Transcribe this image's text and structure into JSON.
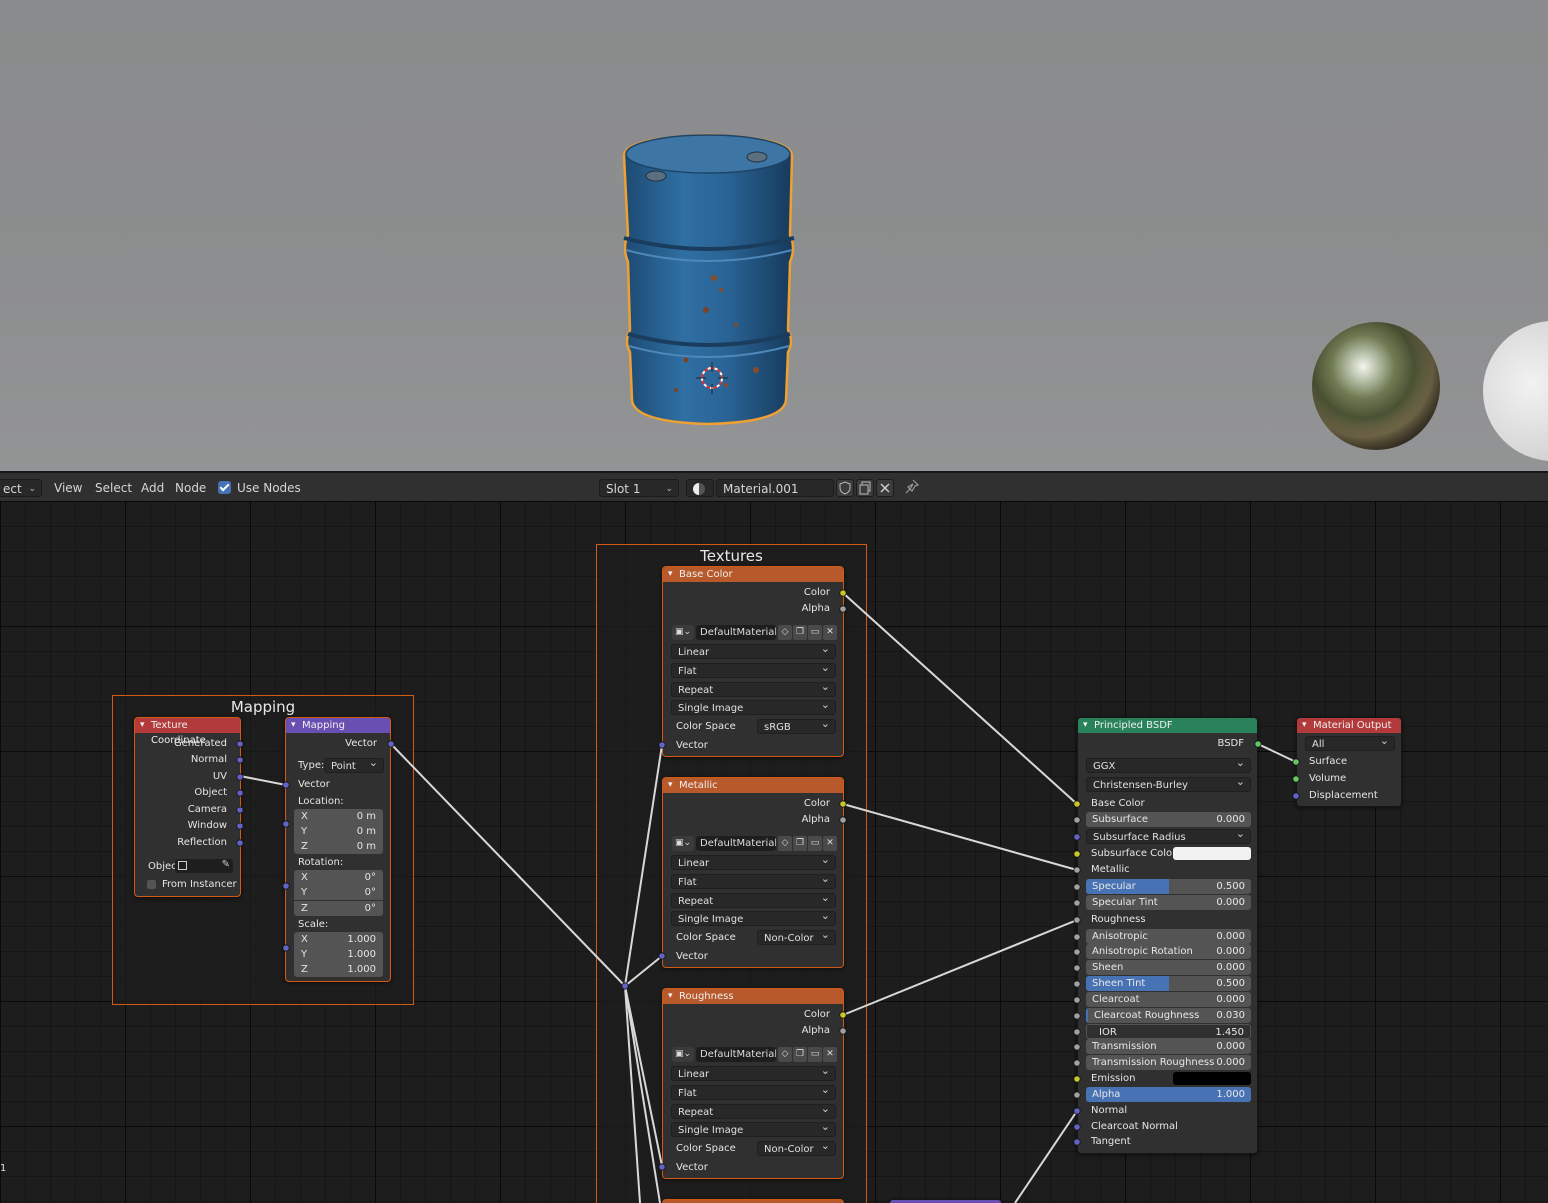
{
  "header": {
    "editor_type": "ect",
    "menu": [
      "View",
      "Select",
      "Add",
      "Node"
    ],
    "use_nodes_label": "Use Nodes",
    "slot": "Slot 1",
    "material_name": "Material.001"
  },
  "frames": {
    "mapping": "Mapping",
    "textures": "Textures"
  },
  "texture_coordinate": {
    "title": "Texture Coordinate",
    "outputs": [
      "Generated",
      "Normal",
      "UV",
      "Object",
      "Camera",
      "Window",
      "Reflection"
    ],
    "object_label": "Objec",
    "from_instancer": "From Instancer"
  },
  "mapping_node": {
    "title": "Mapping",
    "output": "Vector",
    "type_label": "Type:",
    "type_value": "Point",
    "input_vector": "Vector",
    "location_label": "Location:",
    "location": [
      {
        "axis": "X",
        "value": "0 m"
      },
      {
        "axis": "Y",
        "value": "0 m"
      },
      {
        "axis": "Z",
        "value": "0 m"
      }
    ],
    "rotation_label": "Rotation:",
    "rotation": [
      {
        "axis": "X",
        "value": "0°"
      },
      {
        "axis": "Y",
        "value": "0°"
      },
      {
        "axis": "Z",
        "value": "0°"
      }
    ],
    "scale_label": "Scale:",
    "scale": [
      {
        "axis": "X",
        "value": "1.000"
      },
      {
        "axis": "Y",
        "value": "1.000"
      },
      {
        "axis": "Z",
        "value": "1.000"
      }
    ]
  },
  "image_nodes": [
    {
      "title": "Base Color",
      "color_out": "Color",
      "alpha_out": "Alpha",
      "image": "DefaultMaterial_...",
      "interpolation": "Linear",
      "projection": "Flat",
      "extension": "Repeat",
      "source": "Single Image",
      "color_space_label": "Color Space",
      "color_space": "sRGB",
      "vector_in": "Vector"
    },
    {
      "title": "Metallic",
      "color_out": "Color",
      "alpha_out": "Alpha",
      "image": "DefaultMaterial_...",
      "interpolation": "Linear",
      "projection": "Flat",
      "extension": "Repeat",
      "source": "Single Image",
      "color_space_label": "Color Space",
      "color_space": "Non-Color",
      "vector_in": "Vector"
    },
    {
      "title": "Roughness",
      "color_out": "Color",
      "alpha_out": "Alpha",
      "image": "DefaultMaterial_...",
      "interpolation": "Linear",
      "projection": "Flat",
      "extension": "Repeat",
      "source": "Single Image",
      "color_space_label": "Color Space",
      "color_space": "Non-Color",
      "vector_in": "Vector"
    }
  ],
  "principled": {
    "title": "Principled BSDF",
    "output": "BSDF",
    "distribution": "GGX",
    "subsurface_method": "Christensen-Burley",
    "base_color": "Base Color",
    "subsurface": {
      "label": "Subsurface",
      "value": "0.000"
    },
    "subsurface_radius": "Subsurface Radius",
    "subsurface_color": "Subsurface Color",
    "metallic": "Metallic",
    "specular": {
      "label": "Specular",
      "value": "0.500",
      "fraction": 0.5
    },
    "specular_tint": {
      "label": "Specular Tint",
      "value": "0.000"
    },
    "roughness": "Roughness",
    "anisotropic": {
      "label": "Anisotropic",
      "value": "0.000"
    },
    "anisotropic_rotation": {
      "label": "Anisotropic Rotation",
      "value": "0.000"
    },
    "sheen": {
      "label": "Sheen",
      "value": "0.000"
    },
    "sheen_tint": {
      "label": "Sheen Tint",
      "value": "0.500",
      "fraction": 0.5
    },
    "clearcoat": {
      "label": "Clearcoat",
      "value": "0.000"
    },
    "clearcoat_roughness": {
      "label": "Clearcoat Roughness",
      "value": "0.030"
    },
    "ior": {
      "label": "IOR",
      "value": "1.450"
    },
    "transmission": {
      "label": "Transmission",
      "value": "0.000"
    },
    "transmission_roughness": {
      "label": "Transmission Roughness",
      "value": "0.000"
    },
    "emission": "Emission",
    "alpha": {
      "label": "Alpha",
      "value": "1.000",
      "fraction": 1.0
    },
    "normal": "Normal",
    "clearcoat_normal": "Clearcoat Normal",
    "tangent": "Tangent"
  },
  "material_output": {
    "title": "Material Output",
    "target": "All",
    "inputs": [
      "Surface",
      "Volume",
      "Displacement"
    ]
  },
  "colors": {
    "frame_border": "#d35a14",
    "image_header": "#b7592a",
    "input_header": "#b23a3a",
    "vector_header": "#6a4fb2",
    "shader_header": "#29825a",
    "accent": "#4772b3"
  },
  "misc": {
    "corner_digit": "1"
  }
}
